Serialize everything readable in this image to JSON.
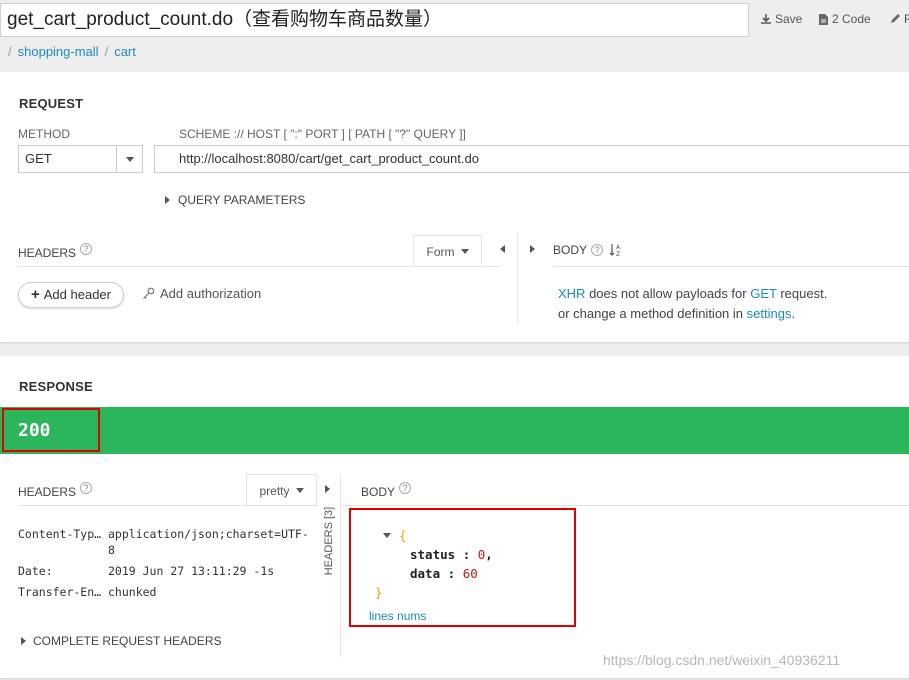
{
  "header": {
    "title": "get_cart_product_count.do（查看购物车商品数量）",
    "save_label": "Save",
    "code_label": "2 Code",
    "cut_label": "F"
  },
  "breadcrumb": {
    "sep": "/",
    "items": [
      "shopping-mall",
      "cart"
    ]
  },
  "request": {
    "title": "REQUEST",
    "method_label": "METHOD",
    "method_value": "GET",
    "url_label": "SCHEME :// HOST [ \":\" PORT ] [ PATH [ \"?\" QUERY ]]",
    "url_value": "http://localhost:8080/cart/get_cart_product_count.do",
    "query_params_label": "QUERY PARAMETERS",
    "headers_label": "HEADERS",
    "headers_help": "?",
    "form_label": "Form",
    "add_header_label": "Add header",
    "add_auth_label": "Add authorization",
    "body_label": "BODY",
    "body_help": "?",
    "body_msg_xhr": "XHR",
    "body_msg_1": " does not allow payloads for ",
    "body_msg_get": "GET",
    "body_msg_2": " request.",
    "body_msg_3": "or change a method definition in ",
    "body_msg_settings": "settings",
    "body_msg_4": "."
  },
  "response": {
    "title": "RESPONSE",
    "status_code": "200",
    "status_color": "#2bb65c",
    "headers_label": "HEADERS",
    "headers_help": "?",
    "pretty_label": "pretty",
    "headers_tab_label": "HEADERS [3]",
    "headers": [
      {
        "name": "Content-Typ…",
        "value": "application/json;charset=UTF-"
      },
      {
        "name": "",
        "value": "8"
      },
      {
        "name": "Date:",
        "value": "2019 Jun 27 13:11:29 -1s"
      },
      {
        "name": "Transfer-En…",
        "value": "chunked"
      }
    ],
    "complete_headers_label": "COMPLETE REQUEST HEADERS",
    "body_label": "BODY",
    "body_help": "?",
    "json": {
      "open": "{",
      "close": "}",
      "k1": "status",
      "v1": "0",
      "k2": "data",
      "v2": "60",
      "colon": ":",
      "comma": ","
    },
    "lines_nums_label": "lines nums"
  },
  "watermark": "https://blog.csdn.net/weixin_40936211"
}
